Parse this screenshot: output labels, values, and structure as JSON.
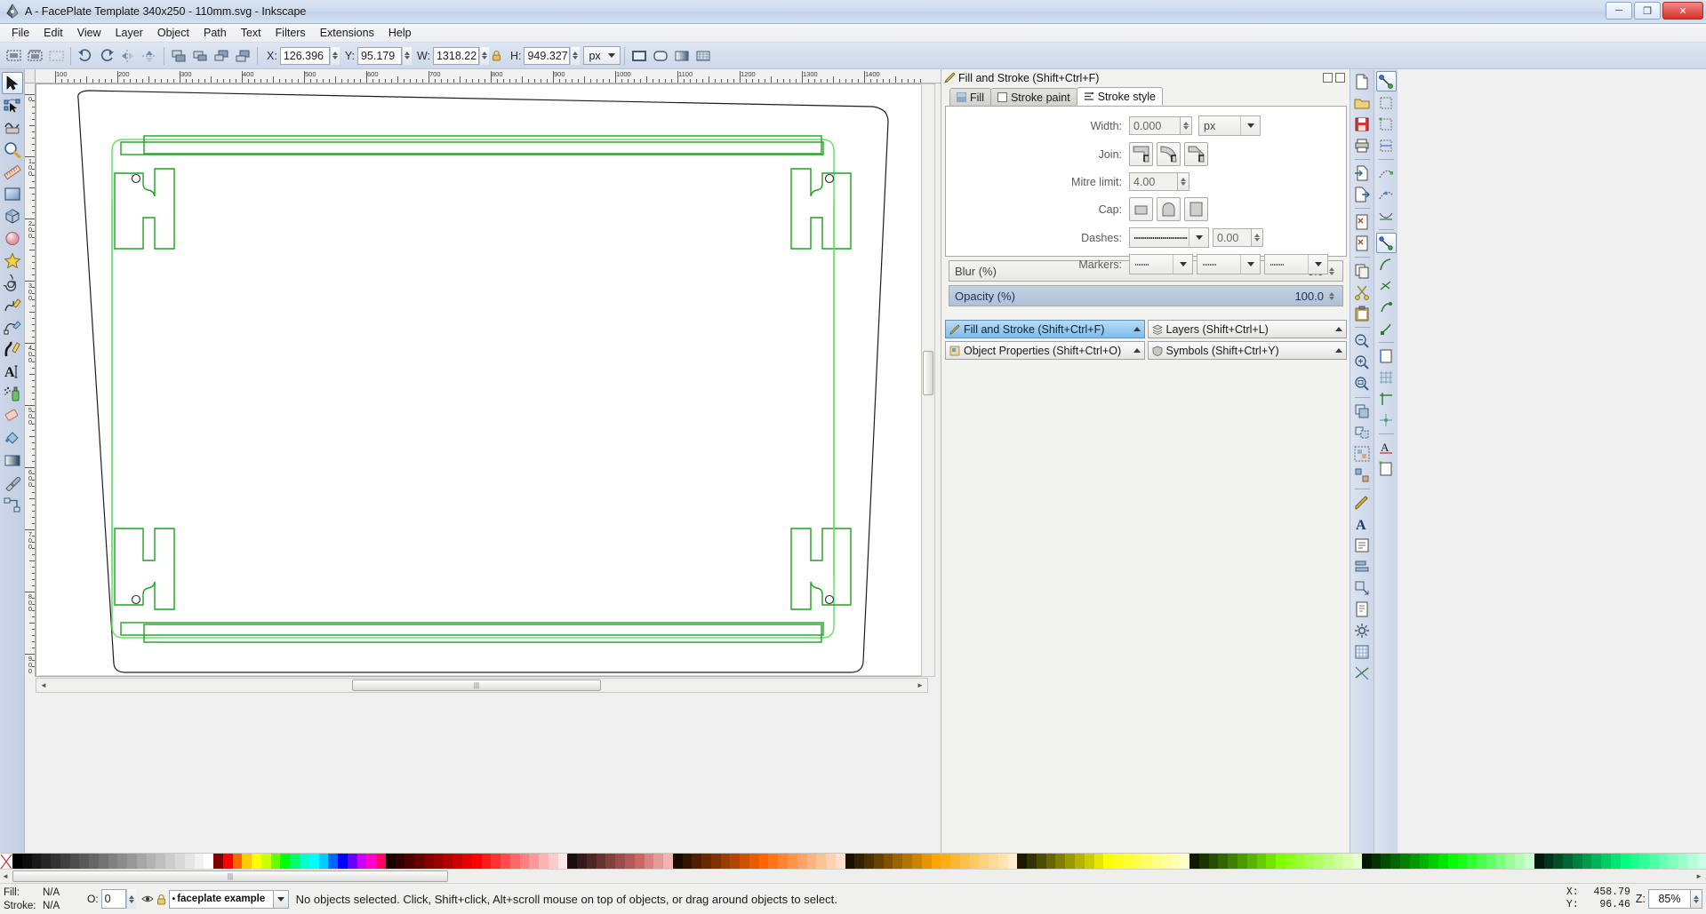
{
  "window": {
    "title": "A - FacePlate Template 340x250 - 110mm.svg - Inkscape",
    "minimize_label": "─",
    "maximize_label": "❐",
    "close_label": "✕"
  },
  "menubar": {
    "items": [
      {
        "label": "File"
      },
      {
        "label": "Edit"
      },
      {
        "label": "View"
      },
      {
        "label": "Layer"
      },
      {
        "label": "Object"
      },
      {
        "label": "Path"
      },
      {
        "label": "Text"
      },
      {
        "label": "Filters"
      },
      {
        "label": "Extensions"
      },
      {
        "label": "Help"
      }
    ]
  },
  "commandbar": {
    "x_label": "X:",
    "x_value": "126.396",
    "y_label": "Y:",
    "y_value": "95.179",
    "w_label": "W:",
    "w_value": "1318.22",
    "h_label": "H:",
    "h_value": "949.327",
    "unit": "px"
  },
  "toolbox": {
    "tools": [
      {
        "name": "selector-tool",
        "label": "Selector"
      },
      {
        "name": "node-tool",
        "label": "Node editor"
      },
      {
        "name": "tweak-tool",
        "label": "Tweak"
      },
      {
        "name": "zoom-tool",
        "label": "Zoom"
      },
      {
        "name": "measure-tool",
        "label": "Measure"
      },
      {
        "name": "rectangle-tool",
        "label": "Rectangle"
      },
      {
        "name": "box3d-tool",
        "label": "3D Box"
      },
      {
        "name": "ellipse-tool",
        "label": "Ellipse"
      },
      {
        "name": "star-tool",
        "label": "Star"
      },
      {
        "name": "spiral-tool",
        "label": "Spiral"
      },
      {
        "name": "pencil-tool",
        "label": "Pencil"
      },
      {
        "name": "bezier-tool",
        "label": "Bezier"
      },
      {
        "name": "calligraphy-tool",
        "label": "Calligraphy"
      },
      {
        "name": "text-tool",
        "label": "Text"
      },
      {
        "name": "spray-tool",
        "label": "Spray"
      },
      {
        "name": "eraser-tool",
        "label": "Eraser"
      },
      {
        "name": "bucket-tool",
        "label": "Paint bucket"
      },
      {
        "name": "gradient-tool",
        "label": "Gradient"
      },
      {
        "name": "dropper-tool",
        "label": "Dropper"
      },
      {
        "name": "connector-tool",
        "label": "Connector"
      }
    ]
  },
  "dialog": {
    "title": "Fill and Stroke (Shift+Ctrl+F)",
    "tabs": [
      {
        "label": "Fill",
        "active": false
      },
      {
        "label": "Stroke paint",
        "active": false
      },
      {
        "label": "Stroke style",
        "active": true
      }
    ],
    "stroke_style": {
      "width_label": "Width:",
      "width_value": "0.000",
      "width_unit": "px",
      "join_label": "Join:",
      "mitre_label": "Mitre limit:",
      "mitre_value": "4.00",
      "cap_label": "Cap:",
      "dashes_label": "Dashes:",
      "dashes_offset": "0.00",
      "markers_label": "Markers:"
    },
    "blur_label": "Blur (%)",
    "blur_value": "0.0",
    "opacity_label": "Opacity (%)",
    "opacity_value": "100.0"
  },
  "dock_tabs": [
    {
      "label": "Fill and Stroke (Shift+Ctrl+F)",
      "icon": "pencil-icon",
      "selected": true
    },
    {
      "label": "Layers (Shift+Ctrl+L)",
      "icon": "layers-icon",
      "selected": false
    },
    {
      "label": "Object Properties (Shift+Ctrl+O)",
      "icon": "properties-icon",
      "selected": false
    },
    {
      "label": "Symbols (Shift+Ctrl+Y)",
      "icon": "symbols-icon",
      "selected": false
    }
  ],
  "rulers": {
    "horizontal_ticks": [
      "100",
      "200",
      "300",
      "400",
      "500",
      "600",
      "700",
      "800",
      "900",
      "1000",
      "1100",
      "1200",
      "1300",
      "1400"
    ],
    "vertical_ticks": [
      "0",
      "100",
      "200",
      "300",
      "400",
      "500",
      "600",
      "700",
      "800",
      "900"
    ]
  },
  "statusbar": {
    "fill_label": "Fill:",
    "fill_value": "N/A",
    "stroke_label": "Stroke:",
    "stroke_value": "N/A",
    "opacity_label": "O:",
    "opacity_value": "0",
    "layer_name": "faceplate example",
    "message": "No objects selected. Click, Shift+click, Alt+scroll mouse on top of objects, or drag around objects to select.",
    "x_label": "X:",
    "x_value": "458.79",
    "y_label": "Y:",
    "y_value": "96.46",
    "zoom_label": "Z:",
    "zoom_value": "85%"
  },
  "palette": {
    "colors": [
      "#000000",
      "#0d0d0d",
      "#1a1a1a",
      "#262626",
      "#333333",
      "#404040",
      "#4d4d4d",
      "#595959",
      "#666666",
      "#737373",
      "#808080",
      "#8c8c8c",
      "#999999",
      "#a6a6a6",
      "#b3b3b3",
      "#bfbfbf",
      "#cccccc",
      "#d9d9d9",
      "#e6e6e6",
      "#f2f2f2",
      "#ffffff",
      "#800000",
      "#ff0000",
      "#ff6600",
      "#ffcc00",
      "#ffff00",
      "#ccff00",
      "#66ff00",
      "#00ff00",
      "#00ff66",
      "#00ffcc",
      "#00ffff",
      "#00ccff",
      "#0066ff",
      "#0000ff",
      "#6600ff",
      "#cc00ff",
      "#ff00cc",
      "#ff0066",
      "#1a0000",
      "#330000",
      "#4d0000",
      "#660000",
      "#800000",
      "#990000",
      "#b30000",
      "#cc0000",
      "#e60000",
      "#ff0000",
      "#ff1a1a",
      "#ff3333",
      "#ff4d4d",
      "#ff6666",
      "#ff8080",
      "#ff9999",
      "#ffb3b3",
      "#ffcccc",
      "#ffe6e6",
      "#1a0d0d",
      "#331a1a",
      "#4d2626",
      "#663333",
      "#804040",
      "#994d4d",
      "#b35959",
      "#cc6666",
      "#d98080",
      "#e69999",
      "#f2b3b3",
      "#1a0a00",
      "#331400",
      "#4d1f00",
      "#662900",
      "#803300",
      "#993d00",
      "#b34700",
      "#cc5200",
      "#e65c00",
      "#ff6600",
      "#ff751a",
      "#ff8533",
      "#ff944d",
      "#ffa366",
      "#ffb380",
      "#ffc299",
      "#ffd1b3",
      "#ffe0cc",
      "#1a1000",
      "#332100",
      "#4d3100",
      "#664200",
      "#805200",
      "#996300",
      "#b37300",
      "#cc8400",
      "#e69400",
      "#ffa500",
      "#ffae1a",
      "#ffb733",
      "#ffc04d",
      "#ffc966",
      "#ffd280",
      "#ffdb99",
      "#ffe4b3",
      "#ffedcc",
      "#1a1a00",
      "#333300",
      "#4d4d00",
      "#666600",
      "#808000",
      "#999900",
      "#b3b300",
      "#cccc00",
      "#e6e600",
      "#ffff00",
      "#ffff1a",
      "#ffff33",
      "#ffff4d",
      "#ffff66",
      "#ffff80",
      "#ffff99",
      "#ffffb3",
      "#ffffcc",
      "#0d1a00",
      "#1a3300",
      "#264d00",
      "#336600",
      "#408000",
      "#4d9900",
      "#59b300",
      "#66cc00",
      "#73e600",
      "#80ff00",
      "#8cff1a",
      "#99ff33",
      "#a6ff4d",
      "#b3ff66",
      "#bfff80",
      "#ccff99",
      "#d9ffb3",
      "#e6ffcc",
      "#001a00",
      "#003300",
      "#004d00",
      "#006600",
      "#008000",
      "#009900",
      "#00b300",
      "#00cc00",
      "#00e600",
      "#00ff00",
      "#1aff1a",
      "#33ff33",
      "#4dff4d",
      "#66ff66",
      "#80ff80",
      "#99ff99",
      "#b3ffb3",
      "#ccffcc",
      "#001a0d",
      "#00331a",
      "#004d26",
      "#006633",
      "#008040",
      "#00994d",
      "#00b359",
      "#00cc66",
      "#00e673",
      "#00ff80",
      "#1aff8c",
      "#33ff99",
      "#4dffa6",
      "#66ffb3",
      "#80ffbf",
      "#99ffcc",
      "#b3ffd9",
      "#ccffe6"
    ]
  }
}
